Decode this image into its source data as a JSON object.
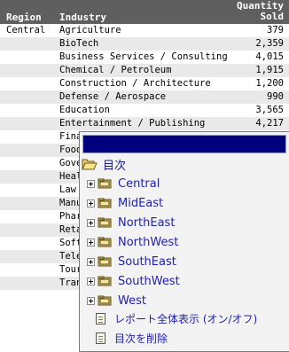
{
  "table": {
    "headers": {
      "region": "Region",
      "industry": "Industry",
      "quantity_line1": "Quantity",
      "quantity_line2": "Sold"
    },
    "rows": [
      {
        "region": "Central",
        "industry": "Agriculture",
        "qty": "379"
      },
      {
        "region": "",
        "industry": "BioTech",
        "qty": "2,359"
      },
      {
        "region": "",
        "industry": "Business Services / Consulting",
        "qty": "4,015"
      },
      {
        "region": "",
        "industry": "Chemical / Petroleum",
        "qty": "1,915"
      },
      {
        "region": "",
        "industry": "Construction / Architecture",
        "qty": "1,200"
      },
      {
        "region": "",
        "industry": "Defense / Aerospace",
        "qty": "990"
      },
      {
        "region": "",
        "industry": "Education",
        "qty": "3,565"
      },
      {
        "region": "",
        "industry": "Entertainment / Publishing",
        "qty": "4,217"
      },
      {
        "region": "",
        "industry": "Fina",
        "qty": ""
      },
      {
        "region": "",
        "industry": "Food",
        "qty": ""
      },
      {
        "region": "",
        "industry": "Gove",
        "qty": ""
      },
      {
        "region": "",
        "industry": "Heal",
        "qty": ""
      },
      {
        "region": "",
        "industry": "Law",
        "qty": ""
      },
      {
        "region": "",
        "industry": "Manu",
        "qty": ""
      },
      {
        "region": "",
        "industry": "Phar",
        "qty": ""
      },
      {
        "region": "",
        "industry": "Reta",
        "qty": ""
      },
      {
        "region": "",
        "industry": "Soft",
        "qty": ""
      },
      {
        "region": "",
        "industry": "Tele",
        "qty": ""
      },
      {
        "region": "",
        "industry": "Tour",
        "qty": ""
      },
      {
        "region": "",
        "industry": "Tran",
        "qty": ""
      }
    ]
  },
  "toc_menu": {
    "root_label": "目次",
    "regions": [
      "Central",
      "MidEast",
      "NorthEast",
      "NorthWest",
      "SouthEast",
      "SouthWest",
      "West"
    ],
    "actions": [
      "レポート全体表示 (オン/オフ)",
      "目次を削除"
    ]
  },
  "colors": {
    "header_bg": "#5f5f5f",
    "alt_row_bg": "#e9e9e9",
    "menu_titlebar": "#00007f",
    "link": "#1f1fb0"
  },
  "icons": {
    "root": "open-folder-icon",
    "expand": "plus-box-icon",
    "region": "folder-icon",
    "action": "document-icon"
  }
}
